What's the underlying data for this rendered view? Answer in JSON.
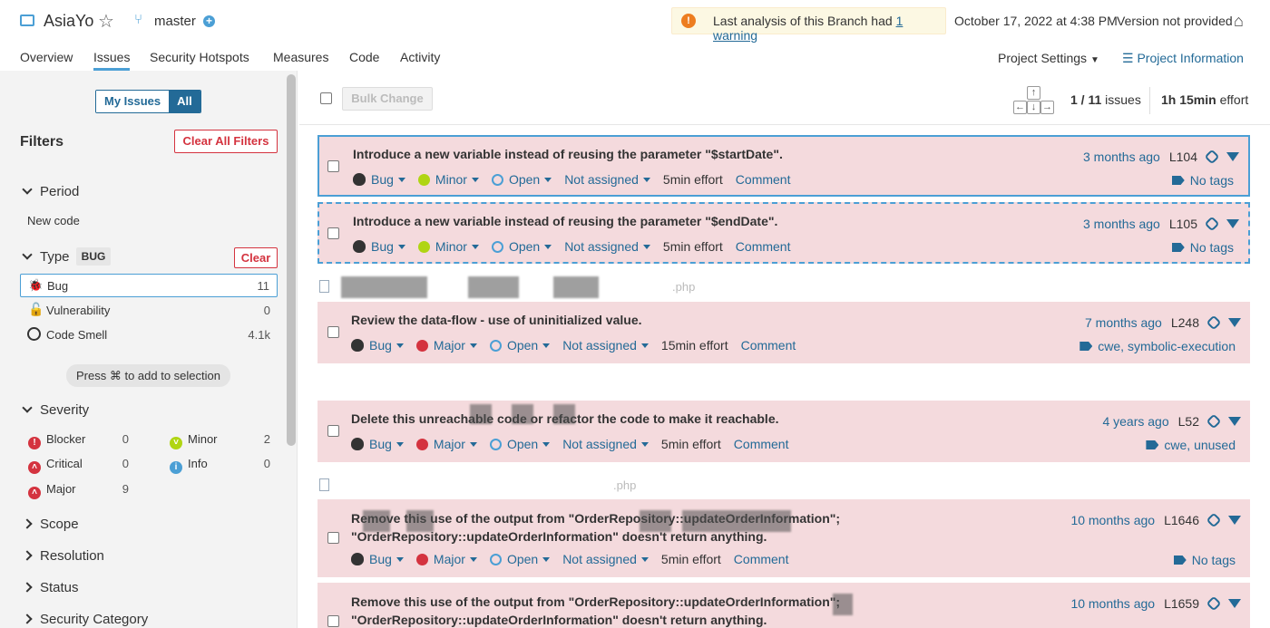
{
  "header": {
    "project": "AsiaYo",
    "branch": "master",
    "warning_prefix": "Last analysis of this Branch had",
    "warning_link": "1 warning",
    "date": "October 17, 2022 at 4:38 PM",
    "version": "Version not provided"
  },
  "nav": {
    "tabs": [
      "Overview",
      "Issues",
      "Security Hotspots",
      "Measures",
      "Code",
      "Activity"
    ],
    "project_settings": "Project Settings",
    "project_information": "Project Information"
  },
  "sidebar": {
    "my_issues": "My Issues",
    "all": "All",
    "filters_title": "Filters",
    "clear_all": "Clear All Filters",
    "period_label": "Period",
    "period_value": "New code",
    "type_label": "Type",
    "type_badge": "BUG",
    "clear": "Clear",
    "types": [
      {
        "label": "Bug",
        "count": "11"
      },
      {
        "label": "Vulnerability",
        "count": "0"
      },
      {
        "label": "Code Smell",
        "count": "4.1k"
      }
    ],
    "press_hint": "Press ⌘ to add to selection",
    "severity_label": "Severity",
    "severities": [
      {
        "label": "Blocker",
        "count": "0"
      },
      {
        "label": "Minor",
        "count": "2"
      },
      {
        "label": "Critical",
        "count": "0"
      },
      {
        "label": "Info",
        "count": "0"
      },
      {
        "label": "Major",
        "count": "9"
      }
    ],
    "collapsed": [
      "Scope",
      "Resolution",
      "Status",
      "Security Category"
    ],
    "colors": {
      "blocker": "#d4333f",
      "critical": "#d4333f",
      "major": "#d4333f",
      "minor": "#b0d513",
      "info": "#4b9fd5"
    }
  },
  "toolbar": {
    "bulk_change": "Bulk Change",
    "issue_position": "1 / 11",
    "issues_word": "issues",
    "effort": "1h 15min",
    "effort_word": "effort"
  },
  "issues": [
    {
      "title": "Introduce a new variable instead of reusing the parameter \"$startDate\".",
      "type": "Bug",
      "severity": "Minor",
      "status": "Open",
      "assignee": "Not assigned",
      "effort": "5min effort",
      "comment": "Comment",
      "age": "3 months ago",
      "line": "L104",
      "tags": "No tags"
    },
    {
      "title": "Introduce a new variable instead of reusing the parameter \"$endDate\".",
      "type": "Bug",
      "severity": "Minor",
      "status": "Open",
      "assignee": "Not assigned",
      "effort": "5min effort",
      "comment": "Comment",
      "age": "3 months ago",
      "line": "L105",
      "tags": "No tags"
    },
    {
      "title": "Review the data-flow - use of uninitialized value.",
      "type": "Bug",
      "severity": "Major",
      "status": "Open",
      "assignee": "Not assigned",
      "effort": "15min effort",
      "comment": "Comment",
      "age": "7 months ago",
      "line": "L248",
      "tags": "cwe, symbolic-execution"
    },
    {
      "title": "Delete this unreachable code or refactor the code to make it reachable.",
      "type": "Bug",
      "severity": "Major",
      "status": "Open",
      "assignee": "Not assigned",
      "effort": "5min effort",
      "comment": "Comment",
      "age": "4 years ago",
      "line": "L52",
      "tags": "cwe, unused"
    },
    {
      "title": "Remove this use of the output from \"OrderRepository::updateOrderInformation\";",
      "title2": "\"OrderRepository::updateOrderInformation\" doesn't return anything.",
      "type": "Bug",
      "severity": "Major",
      "status": "Open",
      "assignee": "Not assigned",
      "effort": "5min effort",
      "comment": "Comment",
      "age": "10 months ago",
      "line": "L1646",
      "tags": "No tags"
    },
    {
      "title": "Remove this use of the output from \"OrderRepository::updateOrderInformation\";",
      "title2": "\"OrderRepository::updateOrderInformation\" doesn't return anything.",
      "age": "10 months ago",
      "line": "L1659"
    }
  ],
  "files": [
    ".php",
    ".php"
  ]
}
